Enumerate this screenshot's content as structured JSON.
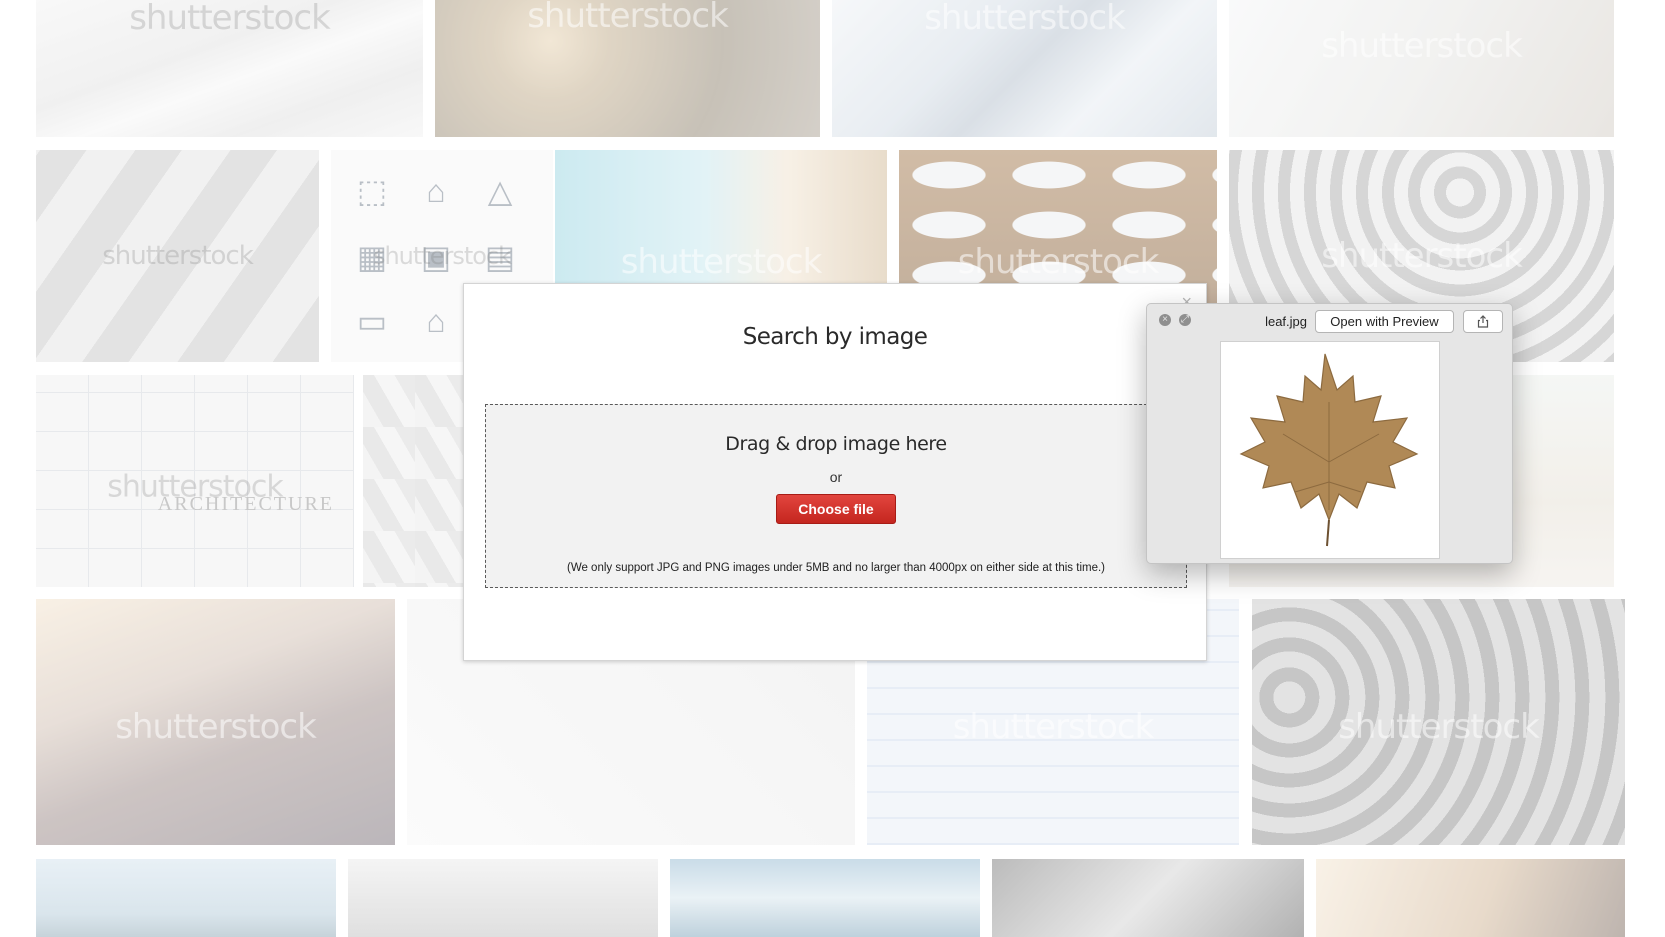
{
  "background": {
    "watermark": "shutterstock",
    "architecture_word": "ARCHITECTURE"
  },
  "modal": {
    "close_glyph": "×",
    "title": "Search by image",
    "drop_text": "Drag & drop image here",
    "or_text": "or",
    "choose_file_label": "Choose file",
    "note": "(We only support JPG and PNG images under 5MB and no larger than 4000px on either side at this time.)"
  },
  "quicklook": {
    "filename": "leaf.jpg",
    "open_button": "Open with Preview",
    "close_glyph": "×",
    "fullscreen_glyph": "⤢"
  },
  "colors": {
    "accent_button": "#d0332b",
    "leaf": "#b08956"
  }
}
